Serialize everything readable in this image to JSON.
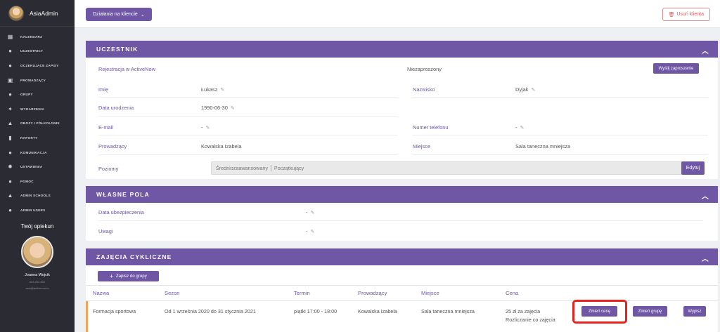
{
  "sidebar": {
    "brand_name": "AsiaAdmin",
    "items": [
      {
        "label": "KALENDARZ",
        "icon": "calendar-icon"
      },
      {
        "label": "UCZESTNICY",
        "icon": "user-icon"
      },
      {
        "label": "OCZEKUJĄCE ZAPISY",
        "icon": "user-clock-icon"
      },
      {
        "label": "PROWADZĄCY",
        "icon": "teacher-icon"
      },
      {
        "label": "GRUPY",
        "icon": "group-icon"
      },
      {
        "label": "WYDARZENIA",
        "icon": "event-icon"
      },
      {
        "label": "OBOZY I PÓŁKOLONIE",
        "icon": "camp-icon"
      },
      {
        "label": "RAPORTY",
        "icon": "report-icon"
      },
      {
        "label": "KOMUNIKACJA",
        "icon": "chat-icon"
      },
      {
        "label": "USTAWIENIA",
        "icon": "gear-icon"
      },
      {
        "label": "POMOC",
        "icon": "help-icon"
      },
      {
        "label": "ADMIN SCHOOLS",
        "icon": "school-icon"
      },
      {
        "label": "ADMIN USERS",
        "icon": "admin-user-icon"
      }
    ],
    "guardian": {
      "title": "Twój opiekun",
      "name": "Joanna Wojcik",
      "phone": "503 204 502",
      "email": "asia@activenow.io"
    }
  },
  "topbar": {
    "actions_label": "Działania na kliencie",
    "delete_label": "Usuń klienta"
  },
  "participant": {
    "header": "UCZESTNIK",
    "registration_label": "Rejestracja w ActiveNow",
    "registration_status": "Niezaproszony",
    "invite_button": "Wyślij zaproszenie",
    "first_name_label": "Imię",
    "first_name": "Łukasz",
    "last_name_label": "Nazwisko",
    "last_name": "Dyjak",
    "birthdate_label": "Data urodzenia",
    "birthdate": "1990-06-30",
    "email_label": "E-mail",
    "email": "-",
    "phone_label": "Numer telefonu",
    "phone": "-",
    "instructor_label": "Prowadzący",
    "instructor": "Kowalska Izabela",
    "place_label": "Miejsce",
    "place": "Sala taneczna mniejsza",
    "levels_label": "Poziomy",
    "levels": [
      "Średniozaawansowany",
      "Początkujący"
    ],
    "edit_button": "Edytuj"
  },
  "custom_fields": {
    "header": "WŁASNE POLA",
    "insurance_label": "Data ubezpieczenia",
    "insurance": "-",
    "notes_label": "Uwagi",
    "notes": "-"
  },
  "classes": {
    "header": "ZAJĘCIA CYKLICZNE",
    "enroll_button": "Zapisz do grupy",
    "columns": [
      "Nazwa",
      "Sezon",
      "Termin",
      "Prowadzący",
      "Miejsce",
      "Cena"
    ],
    "rows": [
      {
        "name": "Formacja sportowa",
        "season": "Od 1 września 2020 do 31 stycznia 2021",
        "term": "piątki 17:00 - 18:00",
        "instructor": "Kowalska Izabela",
        "place": "Sala taneczna mniejsza",
        "price": "25 zł za zajęcia",
        "billing": "Rozliczanie co zajęcia",
        "btn_change_price": "Zmień cenę",
        "btn_change_group": "Zmień grupę",
        "btn_unenroll": "Wypisz"
      }
    ]
  },
  "colors": {
    "accent": "#6f57a6",
    "sidebar_bg": "#2b2c33",
    "danger": "#d45a5a",
    "highlight": "#e8221c"
  }
}
